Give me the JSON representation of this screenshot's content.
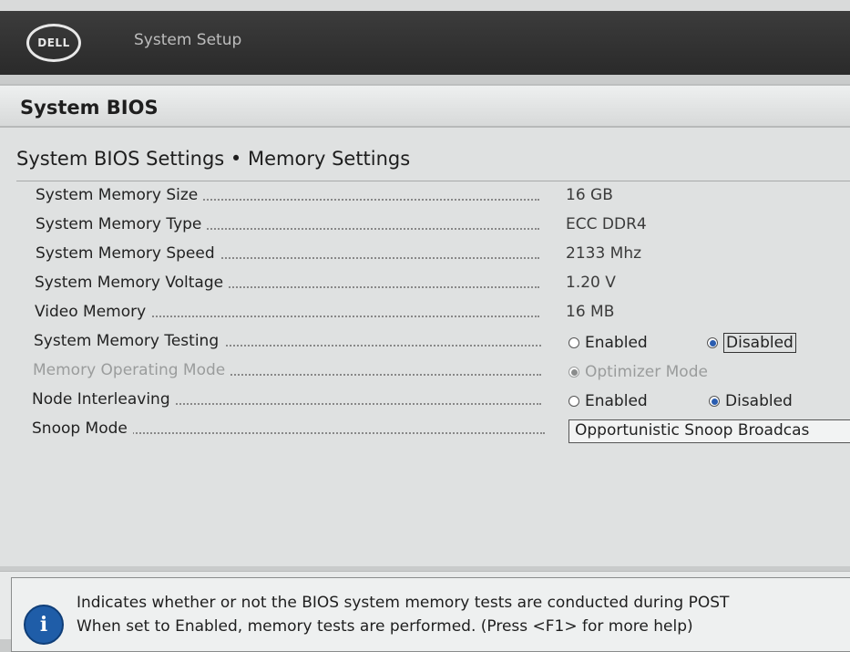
{
  "header": {
    "logo_text": "DELL",
    "title": "System Setup"
  },
  "panel": {
    "title": "System BIOS",
    "breadcrumb": "System BIOS Settings • Memory Settings"
  },
  "settings": [
    {
      "label": "System Memory Size",
      "value": "16 GB"
    },
    {
      "label": "System Memory Type",
      "value": "ECC DDR4"
    },
    {
      "label": "System Memory Speed",
      "value": "2133 Mhz"
    },
    {
      "label": "System Memory Voltage",
      "value": "1.20 V"
    },
    {
      "label": "Video Memory",
      "value": "16 MB"
    },
    {
      "label": "System Memory Testing",
      "options": [
        "Enabled",
        "Disabled"
      ],
      "selected": "Disabled"
    },
    {
      "label": "Memory Operating Mode",
      "options": [
        "Optimizer Mode"
      ],
      "selected": "Optimizer Mode",
      "disabled": true
    },
    {
      "label": "Node Interleaving",
      "options": [
        "Enabled",
        "Disabled"
      ],
      "selected": "Disabled"
    },
    {
      "label": "Snoop Mode",
      "select_value": "Opportunistic Snoop Broadcas"
    }
  ],
  "help": {
    "icon": "info-icon",
    "line1": "Indicates whether or not the BIOS system memory tests are conducted during POST",
    "line2": "When set to Enabled, memory tests are performed. (Press <F1> for more help)"
  }
}
